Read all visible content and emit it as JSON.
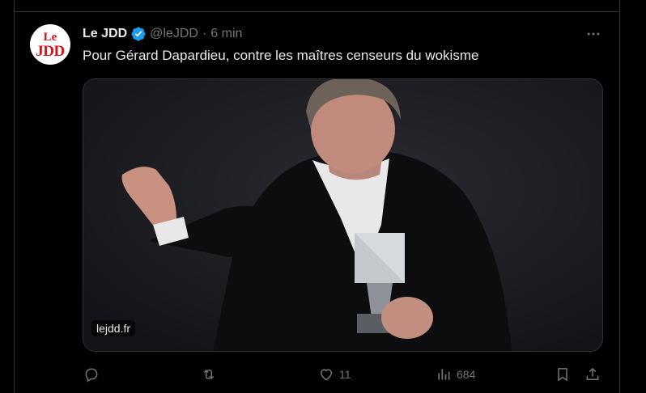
{
  "tweet": {
    "display_name": "Le JDD",
    "handle": "@leJDD",
    "separator": "·",
    "time": "6 min",
    "text": "Pour Gérard Dapardieu, contre les maîtres censeurs du wokisme",
    "avatar": {
      "line1": "Le",
      "line2": "JDD"
    },
    "media": {
      "domain": "lejdd.fr"
    },
    "stats": {
      "replies": "",
      "reposts": "",
      "likes": "11",
      "views": "684"
    }
  },
  "icons": {
    "verified": "verified-badge-icon",
    "more": "more-dots-icon",
    "reply": "reply-icon",
    "repost": "repost-icon",
    "like": "heart-icon",
    "views": "views-chart-icon",
    "bookmark": "bookmark-icon",
    "share": "share-icon"
  },
  "colors": {
    "background": "#000000",
    "text": "#e7e9ea",
    "muted": "#71767b",
    "verified": "#1d9bf0",
    "avatar_red": "#d3141b"
  }
}
